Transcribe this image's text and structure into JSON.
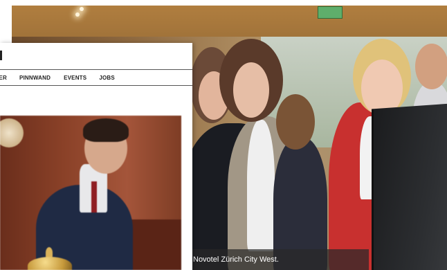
{
  "website": {
    "nav": {
      "items": [
        {
          "label": "IER"
        },
        {
          "label": "PINNWAND"
        },
        {
          "label": "EVENTS"
        },
        {
          "label": "JOBS"
        }
      ]
    }
  },
  "photo": {
    "caption": "Novotel Zürich City West."
  },
  "icons": {
    "exit_sign": "exit-sign-icon",
    "desk_bell": "reception-bell-icon",
    "clock": "wall-clock-icon"
  },
  "colors": {
    "caption_bar": "#282828",
    "nav_text": "#222222",
    "card_background": "#ffffff"
  }
}
